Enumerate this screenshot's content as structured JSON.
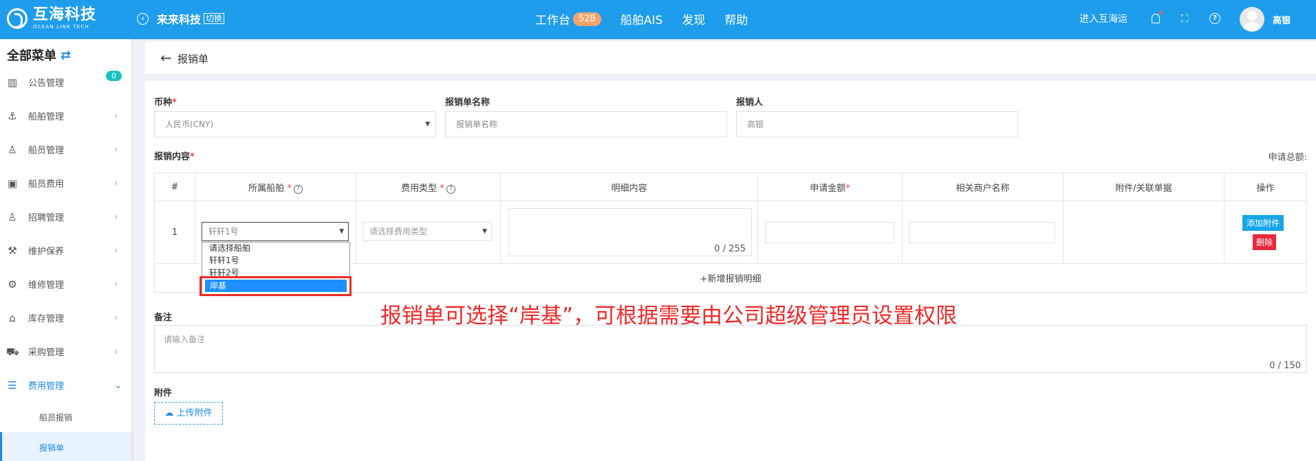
{
  "header": {
    "brand_cn": "互海科技",
    "brand_en": "OCEAN LINK TECH",
    "company": "来来科技",
    "switch_label": "切换",
    "nav": [
      "工作台",
      "船舶AIS",
      "发现",
      "帮助"
    ],
    "workbench_badge": "528",
    "enter_label": "进入互海运",
    "user_name": "高银"
  },
  "sidebar": {
    "title": "全部菜单",
    "items": [
      {
        "label": "公告管理",
        "icon": "book-icon"
      },
      {
        "label": "船舶管理",
        "icon": "anchor-icon"
      },
      {
        "label": "船员管理",
        "icon": "person-icon"
      },
      {
        "label": "船员费用",
        "icon": "wallet-icon"
      },
      {
        "label": "招聘管理",
        "icon": "person-search-icon"
      },
      {
        "label": "维护保养",
        "icon": "hammer-icon"
      },
      {
        "label": "维修管理",
        "icon": "wrench-icon"
      },
      {
        "label": "库存管理",
        "icon": "house-icon"
      },
      {
        "label": "采购管理",
        "icon": "cart-icon"
      },
      {
        "label": "费用管理",
        "icon": "coins-icon"
      }
    ],
    "notice_badge": "0",
    "sub_items": [
      "船员报销",
      "报销单"
    ]
  },
  "breadcrumb": {
    "title": "报销单"
  },
  "form": {
    "currency_label": "币种",
    "currency_value": "人民币(CNY)",
    "name_label": "报销单名称",
    "name_placeholder": "报销单名称",
    "person_label": "报销人",
    "person_value": "高银",
    "content_label": "报销内容",
    "total_label": "申请总额:",
    "table_headers": [
      "#",
      "所属船舶",
      "费用类型",
      "明细内容",
      "申请金额",
      "相关商户名称",
      "附件/关联单据",
      "操作"
    ],
    "row": {
      "index": "1",
      "ship_value": "轩轩1号",
      "type_placeholder": "请选择费用类型",
      "detail_counter": "0 / 255",
      "attach_btn": "添加附件",
      "delete_btn": "删除"
    },
    "add_row": "+新增报销明细",
    "remark_label": "备注",
    "remark_placeholder": "请输入备注",
    "remark_counter": "0 / 150",
    "attachment_label": "附件",
    "upload_btn": "上传附件"
  },
  "dropdown": {
    "options": [
      "请选择船舶",
      "轩轩1号",
      "轩轩2号"
    ],
    "selected": "岸基"
  },
  "annotation": "报销单可选择“岸基”，可根据需要由公司超级管理员设置权限"
}
